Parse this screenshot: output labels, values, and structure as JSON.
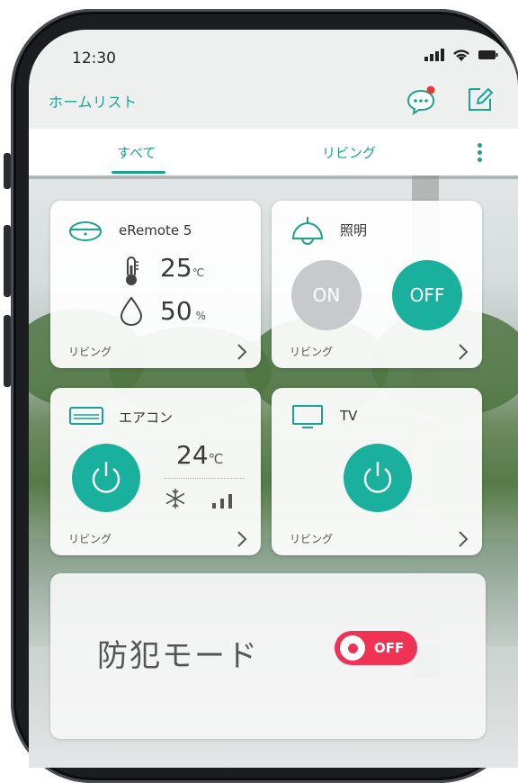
{
  "status": {
    "time": "12:30"
  },
  "header": {
    "title": "ホームリスト"
  },
  "tabs": [
    {
      "label": "すべて"
    },
    {
      "label": "リビング"
    }
  ],
  "cards": {
    "eremote": {
      "title": "eRemote 5",
      "temperature": "25",
      "temperature_unit": "℃",
      "humidity": "50",
      "humidity_unit": "%",
      "room": "リビング"
    },
    "light": {
      "title": "照明",
      "on_label": "ON",
      "off_label": "OFF",
      "room": "リビング"
    },
    "aircon": {
      "title": "エアコン",
      "set_temp": "24",
      "set_temp_unit": "℃",
      "room": "リビング"
    },
    "tv": {
      "title": "TV",
      "room": "リビング"
    }
  },
  "security": {
    "label": "防犯モード",
    "toggle_state": "OFF"
  },
  "colors": {
    "accent": "#1aa391",
    "accent_button": "#1ab09e",
    "toggle_red": "#f03355",
    "notification_dot": "#e53935"
  },
  "icons": {
    "chat": "chat-bubble-icon",
    "edit": "edit-icon",
    "more": "more-vertical-icon",
    "remote": "ir-remote-icon",
    "thermometer": "thermometer-icon",
    "humidity": "water-drop-icon",
    "lamp": "ceiling-lamp-icon",
    "aircon": "air-conditioner-icon",
    "tv": "tv-icon",
    "snowflake": "snowflake-icon",
    "fan_speed": "fan-speed-bars-icon",
    "power": "power-icon",
    "chevron": "chevron-right-icon"
  }
}
